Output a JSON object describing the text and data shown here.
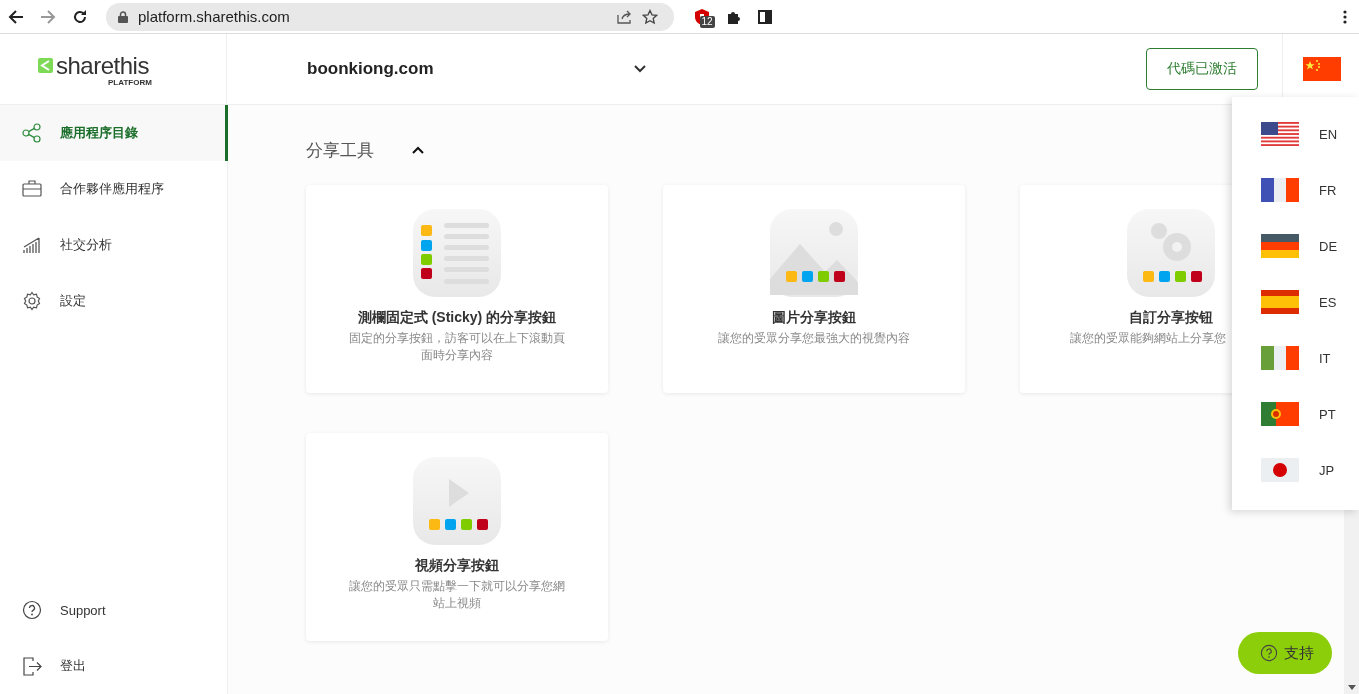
{
  "browser": {
    "url": "platform.sharethis.com",
    "extension_badge": "12",
    "forward_disabled": true
  },
  "header": {
    "logo": "sharethis",
    "logo_sub": "PLATFORM",
    "site": "boonkiong.com",
    "status_button": "代碼已激活"
  },
  "sidebar": {
    "items": [
      {
        "label": "應用程序目錄",
        "kind": "share",
        "selected": true
      },
      {
        "label": "合作夥伴應用程序",
        "kind": "briefcase",
        "selected": false
      },
      {
        "label": "社交分析",
        "kind": "chart",
        "selected": false
      },
      {
        "label": "設定",
        "kind": "gear",
        "selected": false
      }
    ],
    "bottom_items": [
      {
        "label": "Support",
        "kind": "help"
      },
      {
        "label": "登出",
        "kind": "logout"
      }
    ]
  },
  "section": {
    "title": "分享工具",
    "expanded": true
  },
  "cards": [
    {
      "kind": "sticky",
      "title": "測欄固定式 (Sticky) 的分享按鈕",
      "description": "固定的分享按鈕，訪客可以在上下滾動頁面時分享內容"
    },
    {
      "kind": "image",
      "title": "圖片分享按鈕",
      "description": "讓您的受眾分享您最強大的視覺內容"
    },
    {
      "kind": "custom",
      "title": "自訂分享按钮",
      "description": "讓您的受眾能夠網站上分享您",
      "clipped": true
    },
    {
      "kind": "video",
      "title": "視頻分享按鈕",
      "description": "讓您的受眾只需點擊一下就可以分享您網站上視頻"
    }
  ],
  "languages": [
    "EN",
    "FR",
    "DE",
    "ES",
    "IT",
    "PT",
    "JP"
  ],
  "support_button": "支持"
}
